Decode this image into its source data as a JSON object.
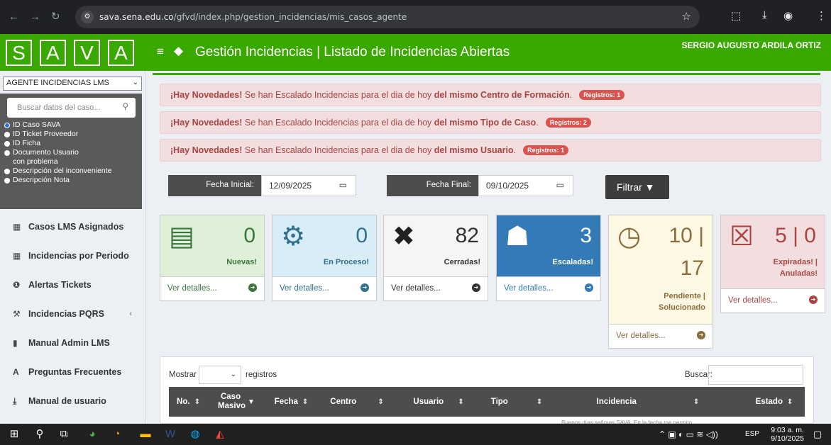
{
  "browser": {
    "url_host": "sava.sena.edu.co",
    "url_path": "/gfvd/index.php/gestion_incidencias/mis_casos_agente"
  },
  "logo_letters": [
    "S",
    "A",
    "V",
    "A"
  ],
  "header": {
    "title": "Gestión Incidencias | Listado de Incidencias Abiertas",
    "user": "SERGIO AUGUSTO ARDILA ORTIZ"
  },
  "sidebar": {
    "role": "AGENTE INCIDENCIAS LMS",
    "search_placeholder": "Buscar datos del caso...",
    "options": [
      "ID Caso SAVA",
      "ID Ticket Proveedor",
      "ID Ficha",
      "Documento Usuario con problema",
      "Descripción del inconveniente",
      "Descripción Nota"
    ],
    "menu": [
      "Casos LMS Asignados",
      "Incidencias por Periodo",
      "Alertas Tickets",
      "Incidencias PQRS",
      "Manual Admin LMS",
      "Preguntas Frecuentes",
      "Manual de usuario"
    ]
  },
  "alerts": [
    {
      "lead": "¡Hay Novedades!",
      "text": " Se han Escalado Incidencias para el dia de hoy ",
      "strong": "del mismo Centro de Formación",
      "end": ".",
      "badge": "Registros: 1"
    },
    {
      "lead": "¡Hay Novedades!",
      "text": " Se han Escalado Incidencias para el dia de hoy ",
      "strong": "del mismo Tipo de Caso",
      "end": ".",
      "badge": "Registros: 2"
    },
    {
      "lead": "¡Hay Novedades!",
      "text": " Se han Escalado Incidencias para el dia de hoy ",
      "strong": "del mismo Usuario",
      "end": ".",
      "badge": "Registros: 1"
    }
  ],
  "filter": {
    "start_label": "Fecha Inicial:",
    "start_value": "12/09/2025",
    "end_label": "Fecha Final:",
    "end_value": "09/10/2025",
    "button": "Filtrar"
  },
  "cards": [
    {
      "value": "0",
      "label": "Nuevas!",
      "link": "Ver detalles...",
      "bg": "#dff0d8",
      "fg": "#3c763d",
      "accent": "#3c763d"
    },
    {
      "value": "0",
      "label": "En Proceso!",
      "link": "Ver detalles...",
      "bg": "#d9edf7",
      "fg": "#31708f",
      "accent": "#31708f"
    },
    {
      "value": "82",
      "label": "Cerradas!",
      "link": "Ver detalles...",
      "bg": "#f5f5f5",
      "fg": "#333333",
      "accent": "#333333"
    },
    {
      "value": "3",
      "label": "Escaladas!",
      "link": "Ver detalles...",
      "bg": "#337ab7",
      "fg": "#ffffff",
      "accent": "#ffffff"
    },
    {
      "value_top": "10 |",
      "value_bottom": "17",
      "label_1": "Pendiente |",
      "label_2": "Solucionado",
      "link": "Ver detalles...",
      "bg": "#fcf8e3",
      "fg": "#8a6d3b",
      "accent": "#8a6d3b"
    },
    {
      "value": "5 | 0",
      "label_1": "Expiradas! |",
      "label_2": "Anuladas!",
      "link": "Ver detalles...",
      "bg": "#f2dede",
      "fg": "#a94442",
      "accent": "#a94442"
    }
  ],
  "table": {
    "show_label": "Mostrar",
    "records_label": "registros",
    "search_label": "Buscar:",
    "columns": [
      "No.",
      "Caso Masivo",
      "Fecha",
      "Centro",
      "Usuario",
      "Tipo",
      "Incidencia",
      "Estado"
    ],
    "first_row_partial": "Buenos días señores SAVA. En la fecha me permito"
  },
  "taskbar": {
    "lang": "ESP",
    "time": "9:03 a. m.",
    "date": "9/10/2025"
  },
  "colors": {
    "brand_green": "#39a900",
    "dark_gray": "#4d4d4d",
    "alert_red": "#a94442"
  }
}
